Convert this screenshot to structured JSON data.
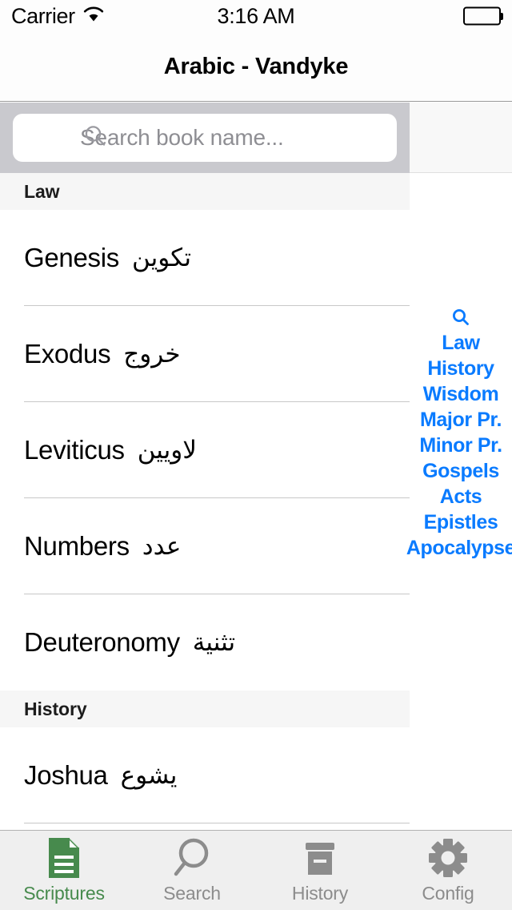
{
  "status_bar": {
    "carrier": "Carrier",
    "wifi_icon": "wifi-icon",
    "time": "3:16 AM",
    "battery_icon": "battery-full-icon"
  },
  "nav_bar": {
    "title": "Arabic - Vandyke"
  },
  "search": {
    "placeholder": "Search book name...",
    "value": "",
    "icon": "search-icon"
  },
  "colors": {
    "accent_blue": "#0a7bff",
    "active_green": "#478a4d",
    "inactive_gray": "#8c8c8c",
    "search_bar_bg": "#c9c9ce",
    "section_header_bg": "#f6f6f6",
    "tab_bar_bg": "#efefef"
  },
  "list": {
    "sections": [
      {
        "title": "Law",
        "books": [
          {
            "name_en": "Genesis",
            "name_ar": "تكوين"
          },
          {
            "name_en": "Exodus",
            "name_ar": "خروج"
          },
          {
            "name_en": "Leviticus",
            "name_ar": "لاويين"
          },
          {
            "name_en": "Numbers",
            "name_ar": "عدد"
          },
          {
            "name_en": "Deuteronomy",
            "name_ar": "تثنية"
          }
        ]
      },
      {
        "title": "History",
        "books": [
          {
            "name_en": "Joshua",
            "name_ar": "يشوع"
          }
        ]
      }
    ]
  },
  "section_index": {
    "search_icon": "search-icon",
    "items": [
      {
        "label": "Law"
      },
      {
        "label": "History"
      },
      {
        "label": "Wisdom"
      },
      {
        "label": "Major Pr."
      },
      {
        "label": "Minor Pr."
      },
      {
        "label": "Gospels"
      },
      {
        "label": "Acts"
      },
      {
        "label": "Epistles"
      },
      {
        "label": "Apocalypse"
      }
    ]
  },
  "tab_bar": {
    "items": [
      {
        "label": "Scriptures",
        "icon": "document-icon",
        "active": true
      },
      {
        "label": "Search",
        "icon": "search-icon",
        "active": false
      },
      {
        "label": "History",
        "icon": "archive-box-icon",
        "active": false
      },
      {
        "label": "Config",
        "icon": "gear-icon",
        "active": false
      }
    ]
  }
}
